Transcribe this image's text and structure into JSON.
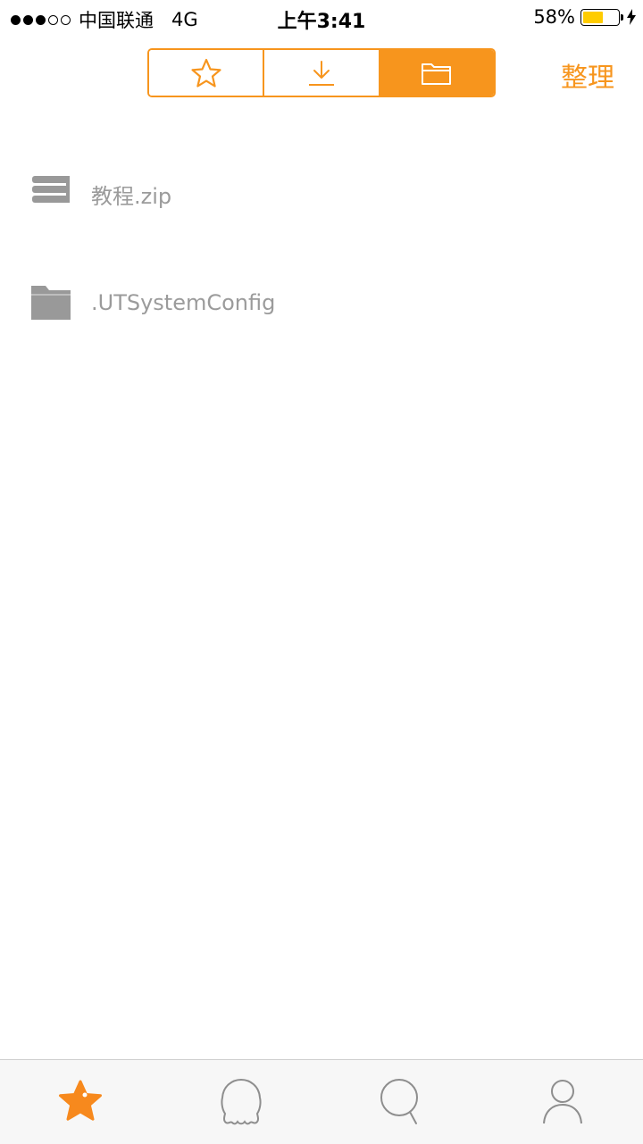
{
  "status_bar": {
    "carrier": "中国联通",
    "network": "4G",
    "time": "上午3:41",
    "battery_percent": "58%",
    "battery_level": 0.58,
    "battery_color": "#ffcc00",
    "signal_bars": 3,
    "signal_total": 5
  },
  "header": {
    "segments": [
      {
        "name": "favorites",
        "icon": "star-outline-icon",
        "active": false
      },
      {
        "name": "downloads",
        "icon": "download-icon",
        "active": false
      },
      {
        "name": "files",
        "icon": "folder-icon",
        "active": true
      }
    ],
    "organize_label": "整理",
    "accent_color": "#f7951d"
  },
  "files": [
    {
      "name": "教程.zip",
      "icon": "archive-icon"
    },
    {
      "name": ".UTSystemConfig",
      "icon": "folder-icon"
    }
  ],
  "tab_bar": {
    "tabs": [
      {
        "name": "favorites",
        "icon": "star-icon",
        "active": true
      },
      {
        "name": "discover",
        "icon": "ghost-icon",
        "active": false
      },
      {
        "name": "search",
        "icon": "search-icon",
        "active": false
      },
      {
        "name": "profile",
        "icon": "person-icon",
        "active": false
      }
    ]
  }
}
